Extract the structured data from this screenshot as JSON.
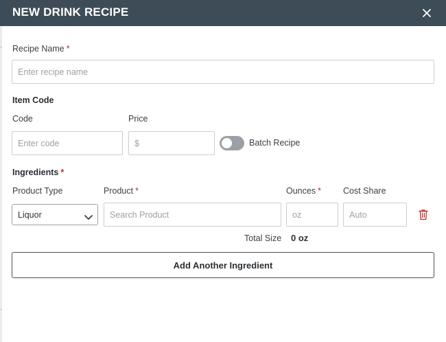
{
  "dialog": {
    "title": "NEW DRINK RECIPE",
    "close_icon": "close-icon"
  },
  "recipe_name": {
    "label": "Recipe Name",
    "required_mark": "*",
    "placeholder": "Enter recipe name",
    "value": ""
  },
  "item_code": {
    "heading": "Item Code",
    "code_label": "Code",
    "code_placeholder": "Enter code",
    "price_label": "Price",
    "price_placeholder": "$",
    "batch_recipe_label": "Batch Recipe",
    "batch_recipe_on": false
  },
  "ingredients": {
    "heading": "Ingredients",
    "required_mark": "*",
    "columns": {
      "product_type": "Product Type",
      "product": "Product",
      "product_required": "*",
      "ounces": "Ounces",
      "ounces_required": "*",
      "cost_share": "Cost Share"
    },
    "row": {
      "product_type": "Liquor",
      "product_placeholder": "Search Product",
      "ounces_placeholder": "oz",
      "cost_share_placeholder": "Auto",
      "delete_icon": "trash-icon"
    },
    "total_size_label": "Total Size",
    "total_size_value": "0 oz",
    "add_button": "Add Another Ingredient"
  },
  "colors": {
    "header_bg": "#3d4c56",
    "required": "#c62828",
    "toggle_off": "#9aa0a6",
    "delete": "#c62828"
  }
}
